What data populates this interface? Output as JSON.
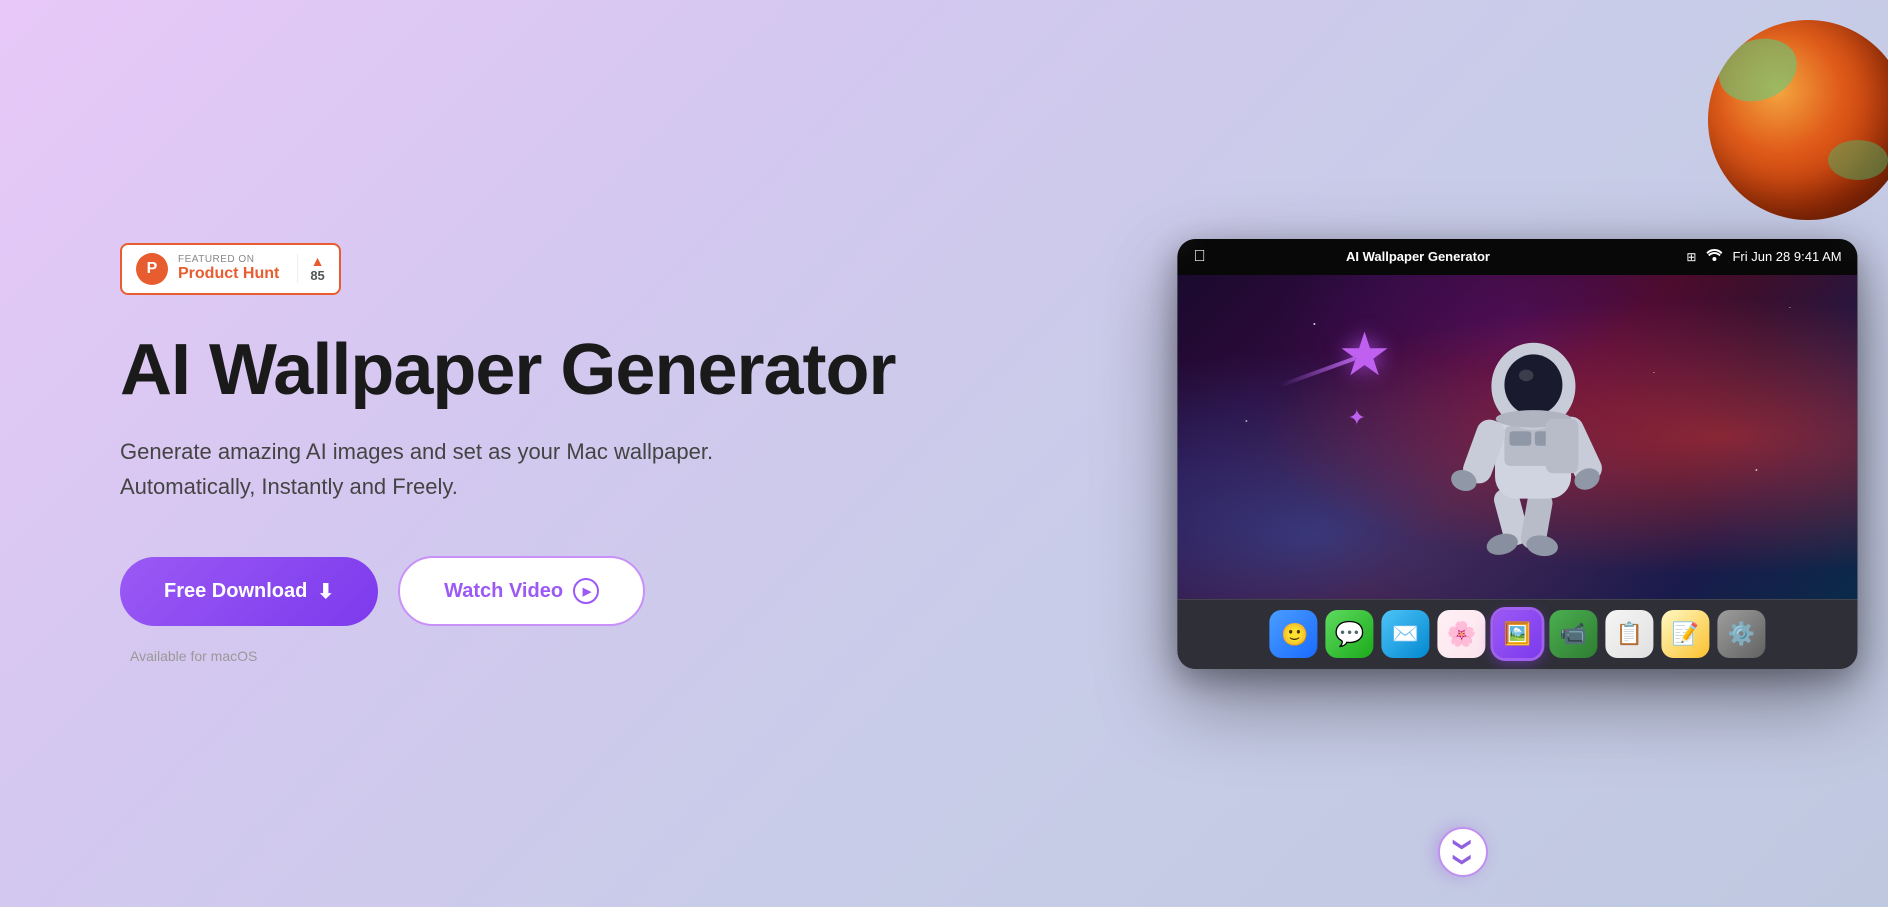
{
  "page": {
    "background": "linear-gradient(135deg, #e8c8f8 0%, #d4c8f0 30%, #c8cce8 60%, #c0c8e0 100%)"
  },
  "product_hunt": {
    "featured_on": "FEATURED ON",
    "name": "Product Hunt",
    "upvotes": "85"
  },
  "hero": {
    "title": "AI Wallpaper Generator",
    "subtitle_line1": "Generate amazing AI images and set as your Mac wallpaper.",
    "subtitle_line2": "Automatically, Instantly and Freely.",
    "download_label": "Free Download",
    "watch_label": "Watch Video",
    "macos_label": "Available for macOS"
  },
  "mac_window": {
    "app_name": "AI Wallpaper Generator",
    "date": "Fri Jun 28",
    "time": "9:41 AM"
  },
  "dock": {
    "icons": [
      {
        "name": "Finder",
        "emoji": "🙂",
        "class": "dock-finder"
      },
      {
        "name": "Messages",
        "emoji": "💬",
        "class": "dock-messages"
      },
      {
        "name": "Mail",
        "emoji": "✉️",
        "class": "dock-mail"
      },
      {
        "name": "Image Playground",
        "emoji": "🌸",
        "class": "dock-imageplay"
      },
      {
        "name": "AI Wallpaper",
        "emoji": "🖼️",
        "class": "dock-ai-wallpaper dock-ai-wallpaper-active"
      },
      {
        "name": "FaceTime",
        "emoji": "📹",
        "class": "dock-facetime"
      },
      {
        "name": "Reminders",
        "emoji": "📋",
        "class": "dock-reminders"
      },
      {
        "name": "Notes",
        "emoji": "📝",
        "class": "dock-notes"
      },
      {
        "name": "System Settings",
        "emoji": "⚙️",
        "class": "dock-settings"
      }
    ]
  }
}
